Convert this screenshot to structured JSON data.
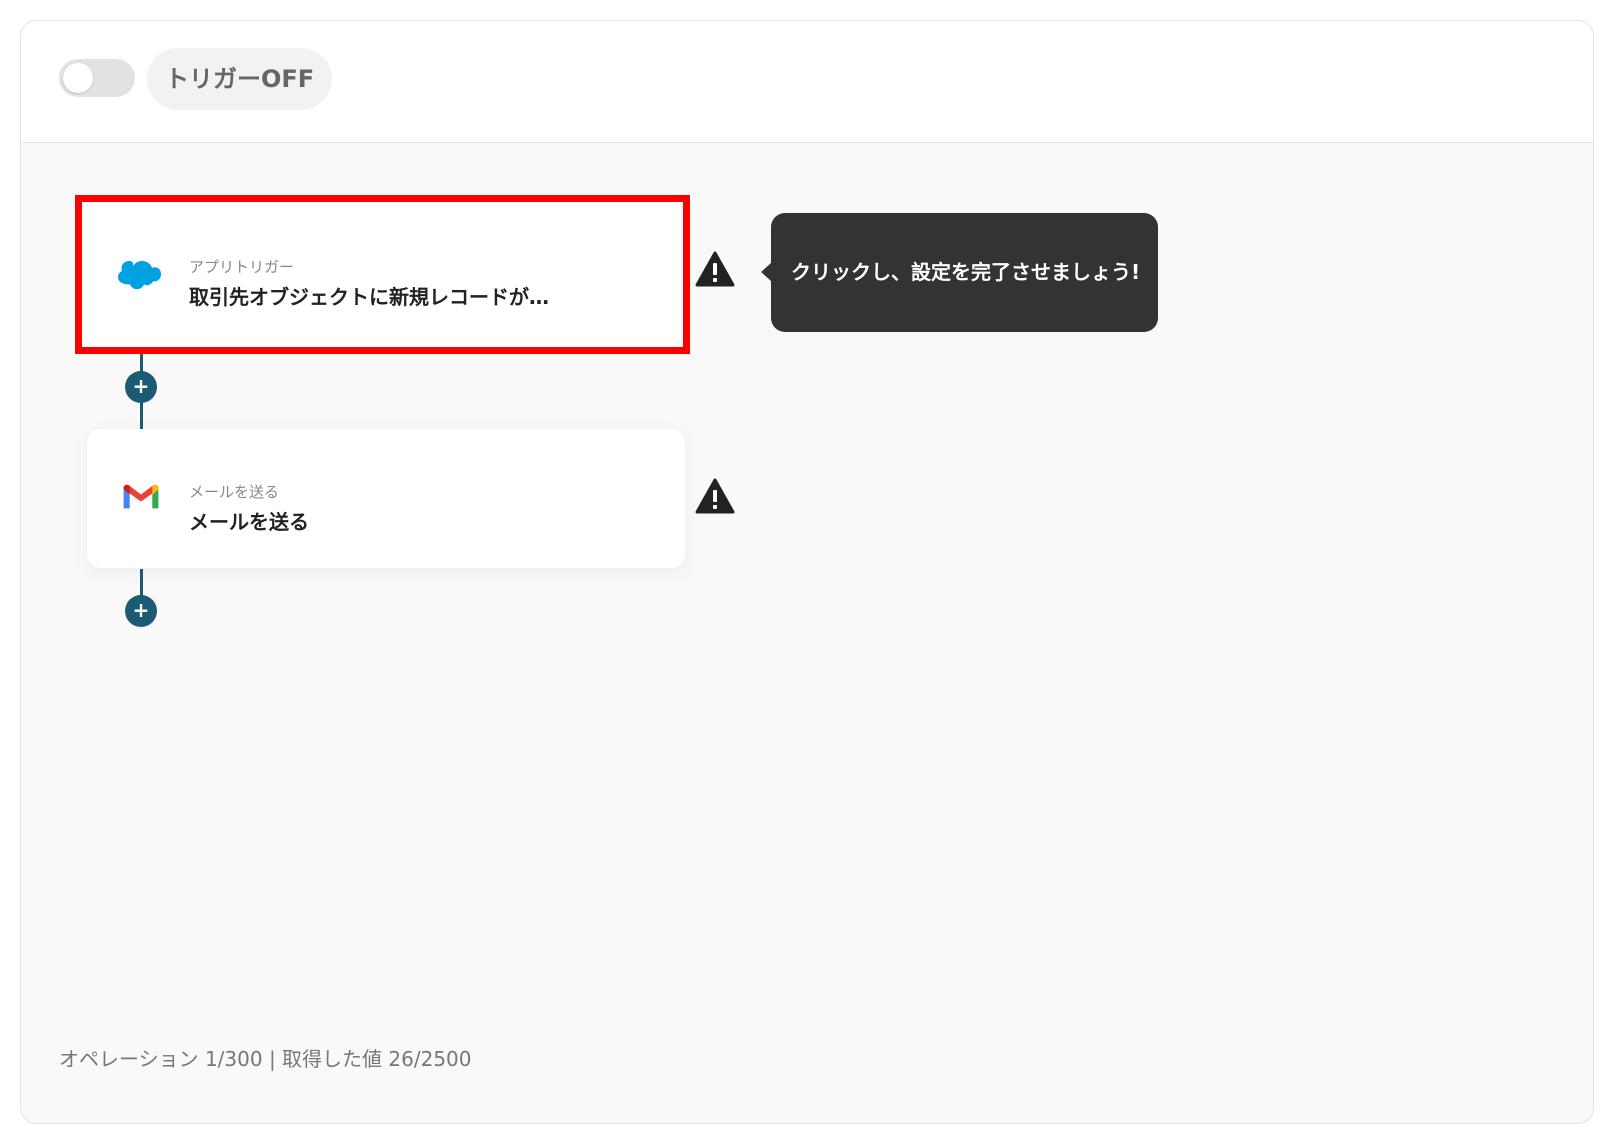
{
  "header": {
    "trigger_toggle": {
      "state": "off"
    },
    "trigger_status": "トリガーOFF"
  },
  "flow": {
    "steps": [
      {
        "app": "salesforce",
        "icon": "salesforce-icon",
        "sub": "アプリトリガー",
        "title": "取引先オブジェクトに新規レコードが…",
        "warning": true
      },
      {
        "app": "gmail",
        "icon": "gmail-icon",
        "sub": "メールを送る",
        "title": "メールを送る",
        "warning": true
      }
    ],
    "add_step_label": "+"
  },
  "tooltip": {
    "text": "クリックし、設定を完了させましょう!"
  },
  "footer": {
    "usage": "オペレーション 1/300 | 取得した値 26/2500"
  },
  "colors": {
    "highlight": "#ff0000",
    "connector": "#1d5b75",
    "tooltip_bg": "#333333",
    "salesforce": "#00a1e0"
  }
}
